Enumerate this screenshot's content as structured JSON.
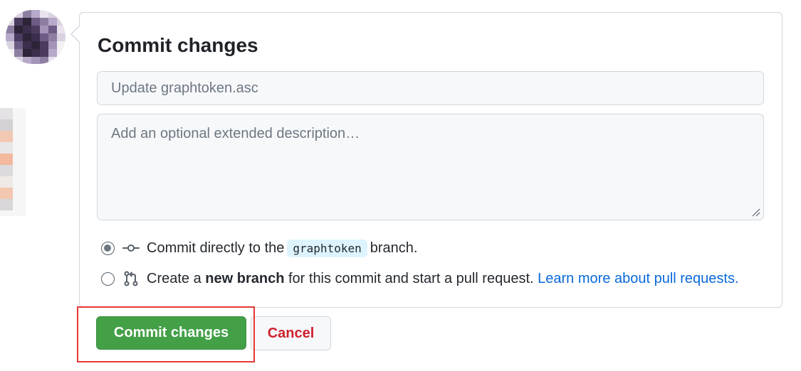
{
  "dialog": {
    "title": "Commit changes"
  },
  "summary_input": {
    "placeholder": "Update graphtoken.asc",
    "value": ""
  },
  "description_textarea": {
    "placeholder": "Add an optional extended description…",
    "value": ""
  },
  "options": {
    "direct": {
      "selected": true,
      "prefix": "Commit directly to the",
      "branch": "graphtoken",
      "suffix": "branch."
    },
    "new_branch": {
      "selected": false,
      "prefix": "Create a",
      "bold": "new branch",
      "suffix": "for this commit and start a pull request.",
      "link": "Learn more about pull requests."
    }
  },
  "actions": {
    "commit_label": "Commit changes",
    "cancel_label": "Cancel"
  },
  "icons": {
    "option_direct": "git-commit-icon",
    "option_new_branch": "git-pull-request-icon"
  },
  "colors": {
    "commit_button": "#43a047",
    "cancel_text": "#cf222e",
    "link": "#0969da",
    "branch_badge": "#ddf4ff",
    "highlight_box": "#e53935"
  }
}
